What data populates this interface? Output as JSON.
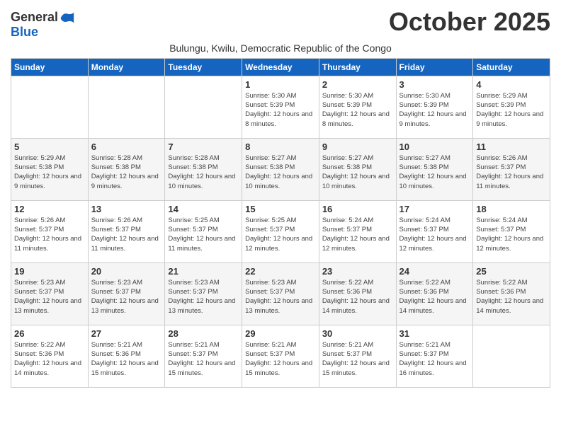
{
  "logo": {
    "general": "General",
    "blue": "Blue"
  },
  "title": "October 2025",
  "subtitle": "Bulungu, Kwilu, Democratic Republic of the Congo",
  "days_of_week": [
    "Sunday",
    "Monday",
    "Tuesday",
    "Wednesday",
    "Thursday",
    "Friday",
    "Saturday"
  ],
  "weeks": [
    [
      {
        "day": "",
        "sunrise": "",
        "sunset": "",
        "daylight": ""
      },
      {
        "day": "",
        "sunrise": "",
        "sunset": "",
        "daylight": ""
      },
      {
        "day": "",
        "sunrise": "",
        "sunset": "",
        "daylight": ""
      },
      {
        "day": "1",
        "sunrise": "Sunrise: 5:30 AM",
        "sunset": "Sunset: 5:39 PM",
        "daylight": "Daylight: 12 hours and 8 minutes."
      },
      {
        "day": "2",
        "sunrise": "Sunrise: 5:30 AM",
        "sunset": "Sunset: 5:39 PM",
        "daylight": "Daylight: 12 hours and 8 minutes."
      },
      {
        "day": "3",
        "sunrise": "Sunrise: 5:30 AM",
        "sunset": "Sunset: 5:39 PM",
        "daylight": "Daylight: 12 hours and 9 minutes."
      },
      {
        "day": "4",
        "sunrise": "Sunrise: 5:29 AM",
        "sunset": "Sunset: 5:39 PM",
        "daylight": "Daylight: 12 hours and 9 minutes."
      }
    ],
    [
      {
        "day": "5",
        "sunrise": "Sunrise: 5:29 AM",
        "sunset": "Sunset: 5:38 PM",
        "daylight": "Daylight: 12 hours and 9 minutes."
      },
      {
        "day": "6",
        "sunrise": "Sunrise: 5:28 AM",
        "sunset": "Sunset: 5:38 PM",
        "daylight": "Daylight: 12 hours and 9 minutes."
      },
      {
        "day": "7",
        "sunrise": "Sunrise: 5:28 AM",
        "sunset": "Sunset: 5:38 PM",
        "daylight": "Daylight: 12 hours and 10 minutes."
      },
      {
        "day": "8",
        "sunrise": "Sunrise: 5:27 AM",
        "sunset": "Sunset: 5:38 PM",
        "daylight": "Daylight: 12 hours and 10 minutes."
      },
      {
        "day": "9",
        "sunrise": "Sunrise: 5:27 AM",
        "sunset": "Sunset: 5:38 PM",
        "daylight": "Daylight: 12 hours and 10 minutes."
      },
      {
        "day": "10",
        "sunrise": "Sunrise: 5:27 AM",
        "sunset": "Sunset: 5:38 PM",
        "daylight": "Daylight: 12 hours and 10 minutes."
      },
      {
        "day": "11",
        "sunrise": "Sunrise: 5:26 AM",
        "sunset": "Sunset: 5:37 PM",
        "daylight": "Daylight: 12 hours and 11 minutes."
      }
    ],
    [
      {
        "day": "12",
        "sunrise": "Sunrise: 5:26 AM",
        "sunset": "Sunset: 5:37 PM",
        "daylight": "Daylight: 12 hours and 11 minutes."
      },
      {
        "day": "13",
        "sunrise": "Sunrise: 5:26 AM",
        "sunset": "Sunset: 5:37 PM",
        "daylight": "Daylight: 12 hours and 11 minutes."
      },
      {
        "day": "14",
        "sunrise": "Sunrise: 5:25 AM",
        "sunset": "Sunset: 5:37 PM",
        "daylight": "Daylight: 12 hours and 11 minutes."
      },
      {
        "day": "15",
        "sunrise": "Sunrise: 5:25 AM",
        "sunset": "Sunset: 5:37 PM",
        "daylight": "Daylight: 12 hours and 12 minutes."
      },
      {
        "day": "16",
        "sunrise": "Sunrise: 5:24 AM",
        "sunset": "Sunset: 5:37 PM",
        "daylight": "Daylight: 12 hours and 12 minutes."
      },
      {
        "day": "17",
        "sunrise": "Sunrise: 5:24 AM",
        "sunset": "Sunset: 5:37 PM",
        "daylight": "Daylight: 12 hours and 12 minutes."
      },
      {
        "day": "18",
        "sunrise": "Sunrise: 5:24 AM",
        "sunset": "Sunset: 5:37 PM",
        "daylight": "Daylight: 12 hours and 12 minutes."
      }
    ],
    [
      {
        "day": "19",
        "sunrise": "Sunrise: 5:23 AM",
        "sunset": "Sunset: 5:37 PM",
        "daylight": "Daylight: 12 hours and 13 minutes."
      },
      {
        "day": "20",
        "sunrise": "Sunrise: 5:23 AM",
        "sunset": "Sunset: 5:37 PM",
        "daylight": "Daylight: 12 hours and 13 minutes."
      },
      {
        "day": "21",
        "sunrise": "Sunrise: 5:23 AM",
        "sunset": "Sunset: 5:37 PM",
        "daylight": "Daylight: 12 hours and 13 minutes."
      },
      {
        "day": "22",
        "sunrise": "Sunrise: 5:23 AM",
        "sunset": "Sunset: 5:37 PM",
        "daylight": "Daylight: 12 hours and 13 minutes."
      },
      {
        "day": "23",
        "sunrise": "Sunrise: 5:22 AM",
        "sunset": "Sunset: 5:36 PM",
        "daylight": "Daylight: 12 hours and 14 minutes."
      },
      {
        "day": "24",
        "sunrise": "Sunrise: 5:22 AM",
        "sunset": "Sunset: 5:36 PM",
        "daylight": "Daylight: 12 hours and 14 minutes."
      },
      {
        "day": "25",
        "sunrise": "Sunrise: 5:22 AM",
        "sunset": "Sunset: 5:36 PM",
        "daylight": "Daylight: 12 hours and 14 minutes."
      }
    ],
    [
      {
        "day": "26",
        "sunrise": "Sunrise: 5:22 AM",
        "sunset": "Sunset: 5:36 PM",
        "daylight": "Daylight: 12 hours and 14 minutes."
      },
      {
        "day": "27",
        "sunrise": "Sunrise: 5:21 AM",
        "sunset": "Sunset: 5:36 PM",
        "daylight": "Daylight: 12 hours and 15 minutes."
      },
      {
        "day": "28",
        "sunrise": "Sunrise: 5:21 AM",
        "sunset": "Sunset: 5:37 PM",
        "daylight": "Daylight: 12 hours and 15 minutes."
      },
      {
        "day": "29",
        "sunrise": "Sunrise: 5:21 AM",
        "sunset": "Sunset: 5:37 PM",
        "daylight": "Daylight: 12 hours and 15 minutes."
      },
      {
        "day": "30",
        "sunrise": "Sunrise: 5:21 AM",
        "sunset": "Sunset: 5:37 PM",
        "daylight": "Daylight: 12 hours and 15 minutes."
      },
      {
        "day": "31",
        "sunrise": "Sunrise: 5:21 AM",
        "sunset": "Sunset: 5:37 PM",
        "daylight": "Daylight: 12 hours and 16 minutes."
      },
      {
        "day": "",
        "sunrise": "",
        "sunset": "",
        "daylight": ""
      }
    ]
  ]
}
